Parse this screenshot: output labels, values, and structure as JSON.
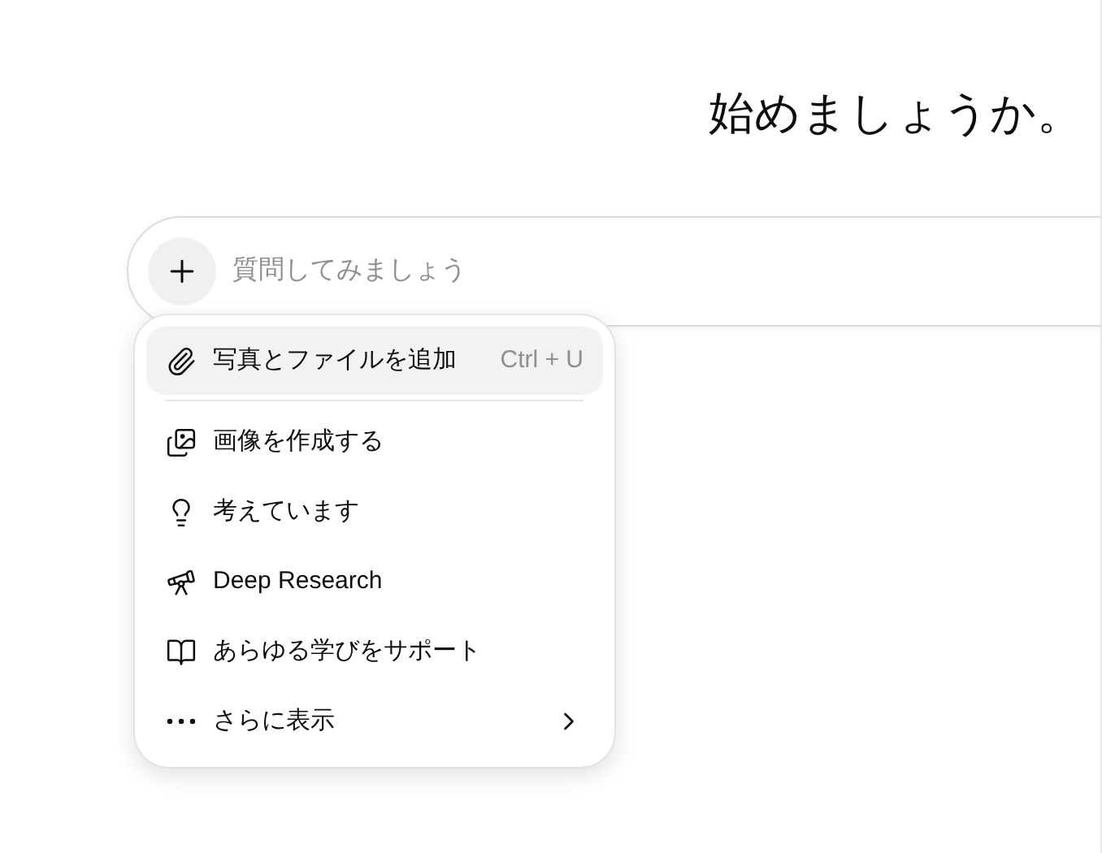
{
  "heading": "始めましょうか。",
  "composer": {
    "placeholder": "質問してみましょう"
  },
  "menu": {
    "items": [
      {
        "kind": "attach",
        "label": "写真とファイルを追加",
        "shortcut": "Ctrl + U",
        "selected": true
      },
      {
        "kind": "image",
        "label": "画像を作成する",
        "selected": false
      },
      {
        "kind": "think",
        "label": "考えています",
        "selected": false
      },
      {
        "kind": "research",
        "label": "Deep Research",
        "selected": false
      },
      {
        "kind": "study",
        "label": "あらゆる学びをサポート",
        "selected": false
      },
      {
        "kind": "more",
        "label": "さらに表示",
        "selected": false
      }
    ]
  }
}
